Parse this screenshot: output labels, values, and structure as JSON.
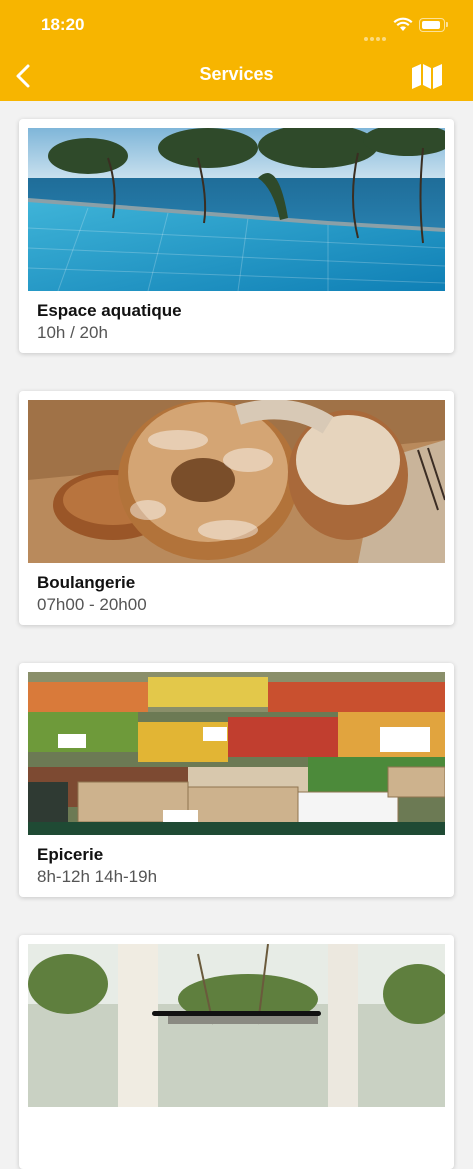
{
  "status_bar": {
    "time": "18:20"
  },
  "nav": {
    "title": "Services",
    "back_icon": "chevron-left-icon",
    "map_icon": "map-icon"
  },
  "colors": {
    "accent": "#f7b500",
    "background": "#f2f2f2"
  },
  "services": [
    {
      "name": "Espace aquatique",
      "hours": "10h / 20h",
      "image": "infinity-pool-photo"
    },
    {
      "name": "Boulangerie",
      "hours": "07h00 - 20h00",
      "image": "bread-photo"
    },
    {
      "name": "Epicerie",
      "hours": "8h-12h 14h-19h",
      "image": "market-produce-photo"
    },
    {
      "name": "",
      "hours": "",
      "image": "garden-terrace-photo"
    }
  ]
}
